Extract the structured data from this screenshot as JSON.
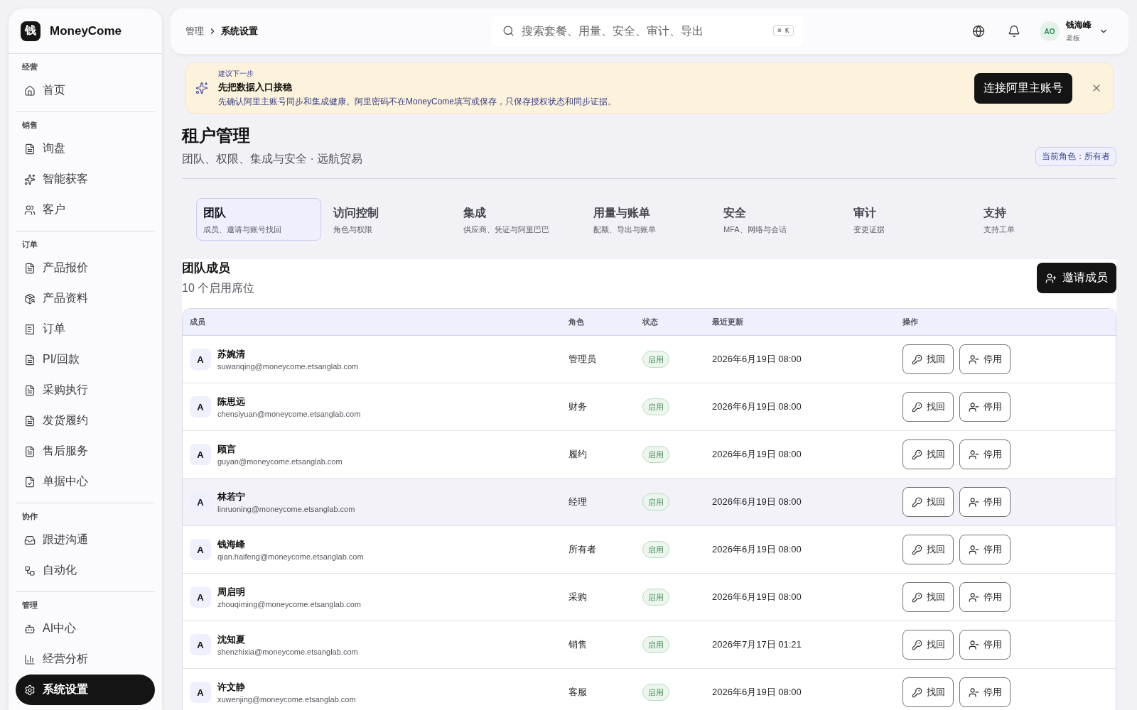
{
  "sidebar": {
    "brand": {
      "logo": "钱",
      "name": "MoneyCome"
    },
    "sections": [
      {
        "title": "经营",
        "items": [
          {
            "label": "首页",
            "selected": false
          }
        ]
      },
      {
        "title": "销售",
        "items": [
          {
            "label": "询盘",
            "selected": false
          },
          {
            "label": "智能获客",
            "selected": false
          },
          {
            "label": "客户",
            "selected": false
          }
        ]
      },
      {
        "title": "订单",
        "items": [
          {
            "label": "产品报价",
            "selected": false
          },
          {
            "label": "产品资料",
            "selected": false
          },
          {
            "label": "订单",
            "selected": false
          },
          {
            "label": "PI/回款",
            "selected": false
          },
          {
            "label": "采购执行",
            "selected": false
          },
          {
            "label": "发货履约",
            "selected": false
          },
          {
            "label": "售后服务",
            "selected": false
          },
          {
            "label": "单据中心",
            "selected": false
          }
        ]
      },
      {
        "title": "协作",
        "items": [
          {
            "label": "跟进沟通",
            "selected": false
          },
          {
            "label": "自动化",
            "selected": false
          }
        ]
      },
      {
        "title": "管理",
        "items": [
          {
            "label": "AI中心",
            "selected": false
          },
          {
            "label": "经营分析",
            "selected": false
          },
          {
            "label": "系统设置",
            "selected": true
          }
        ]
      }
    ]
  },
  "topbar": {
    "breadcrumb": [
      "管理",
      "系统设置"
    ],
    "search": {
      "placeholder": "搜索套餐、用量、安全、审计、导出",
      "shortcut": "⌘ K"
    },
    "user": {
      "initials": "AO",
      "name": "钱海峰",
      "role": "老板"
    }
  },
  "banner": {
    "eyebrow": "建议下一步",
    "title": "先把数据入口接稳",
    "message": "先确认阿里主账号同步和集成健康。阿里密码不在MoneyCome填写或保存，只保存授权状态和同步证据。",
    "action": "连接阿里主账号"
  },
  "header": {
    "title": "租户管理",
    "subtitle": "团队、权限、集成与安全 · 远航贸易",
    "role_badge": "当前角色：所有者"
  },
  "tabs": [
    {
      "label": "团队",
      "description": "成员、邀请与账号找回",
      "selected": true
    },
    {
      "label": "访问控制",
      "description": "角色与权限",
      "selected": false
    },
    {
      "label": "集成",
      "description": "供应商、凭证与阿里巴巴",
      "selected": false
    },
    {
      "label": "用量与账单",
      "description": "配额、导出与账单",
      "selected": false
    },
    {
      "label": "安全",
      "description": "MFA、网络与会话",
      "selected": false
    },
    {
      "label": "审计",
      "description": "变更证据",
      "selected": false
    },
    {
      "label": "支持",
      "description": "支持工单",
      "selected": false
    }
  ],
  "members": {
    "title": "团队成员",
    "subtitle": "10 个启用席位",
    "invite_button": "邀请成员",
    "table": {
      "columns": [
        "成员",
        "角色",
        "状态",
        "最近更新",
        "操作"
      ],
      "rows": [
        {
          "avatar": "A",
          "name": "苏婉清",
          "email": "suwanqing@moneycome.etsanglab.com",
          "role": "管理员",
          "status": "启用",
          "updated": "2026年6月19日 08:00",
          "hovered": false,
          "actions": [
            {
              "kind": "recover",
              "label": "找回"
            },
            {
              "kind": "deactivate",
              "label": "停用"
            }
          ]
        },
        {
          "avatar": "A",
          "name": "陈思远",
          "email": "chensiyuan@moneycome.etsanglab.com",
          "role": "财务",
          "status": "启用",
          "updated": "2026年6月19日 08:00",
          "hovered": false,
          "actions": [
            {
              "kind": "recover",
              "label": "找回"
            },
            {
              "kind": "deactivate",
              "label": "停用"
            }
          ]
        },
        {
          "avatar": "A",
          "name": "顾言",
          "email": "guyan@moneycome.etsanglab.com",
          "role": "履约",
          "status": "启用",
          "updated": "2026年6月19日 08:00",
          "hovered": false,
          "actions": [
            {
              "kind": "recover",
              "label": "找回"
            },
            {
              "kind": "deactivate",
              "label": "停用"
            }
          ]
        },
        {
          "avatar": "A",
          "name": "林若宁",
          "email": "linruoning@moneycome.etsanglab.com",
          "role": "经理",
          "status": "启用",
          "updated": "2026年6月19日 08:00",
          "hovered": true,
          "actions": [
            {
              "kind": "recover",
              "label": "找回"
            },
            {
              "kind": "deactivate",
              "label": "停用"
            }
          ]
        },
        {
          "avatar": "A",
          "name": "钱海峰",
          "email": "qian.haifeng@moneycome.etsanglab.com",
          "role": "所有者",
          "status": "启用",
          "updated": "2026年6月19日 08:00",
          "hovered": false,
          "actions": [
            {
              "kind": "recover",
              "label": "找回"
            },
            {
              "kind": "deactivate",
              "label": "停用"
            }
          ]
        },
        {
          "avatar": "A",
          "name": "周启明",
          "email": "zhouqiming@moneycome.etsanglab.com",
          "role": "采购",
          "status": "启用",
          "updated": "2026年6月19日 08:00",
          "hovered": false,
          "actions": [
            {
              "kind": "recover",
              "label": "找回"
            },
            {
              "kind": "deactivate",
              "label": "停用"
            }
          ]
        },
        {
          "avatar": "A",
          "name": "沈知夏",
          "email": "shenzhixia@moneycome.etsanglab.com",
          "role": "销售",
          "status": "启用",
          "updated": "2026年7月17日 01:21",
          "hovered": false,
          "actions": [
            {
              "kind": "recover",
              "label": "找回"
            },
            {
              "kind": "deactivate",
              "label": "停用"
            }
          ]
        },
        {
          "avatar": "A",
          "name": "许文静",
          "email": "xuwenjing@moneycome.etsanglab.com",
          "role": "客服",
          "status": "启用",
          "updated": "2026年6月19日 08:00",
          "hovered": false,
          "actions": [
            {
              "kind": "recover",
              "label": "找回"
            },
            {
              "kind": "deactivate",
              "label": "停用"
            }
          ]
        }
      ]
    }
  }
}
